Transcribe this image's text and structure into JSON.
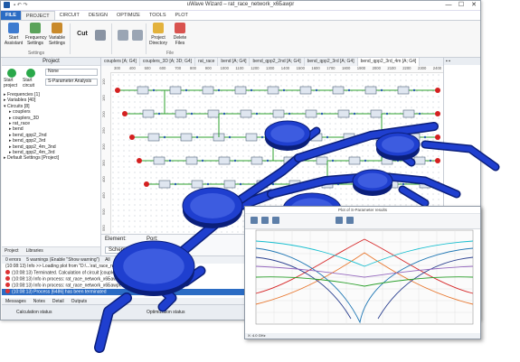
{
  "window": {
    "title": "uWave Wizard – rat_race_network_x6Бawpr",
    "qa_icons": [
      "save-icon",
      "undo-icon",
      "redo-icon"
    ],
    "controls": {
      "minimize": "—",
      "maximize": "☐",
      "close": "✕"
    }
  },
  "ribbon": {
    "tabs": [
      "FILE",
      "PROJECT",
      "CIRCUIT",
      "DESIGN",
      "OPTIMIZE",
      "TOOLS",
      "PLOT"
    ],
    "active_tab": "PROJECT",
    "settings_buttons": [
      "Start Assistant",
      "Frequency Settings",
      "Variable Settings"
    ],
    "settings_group": "Settings",
    "cut_label": "Cut",
    "file_buttons": [
      "Project Directory",
      "Delete Files"
    ],
    "file_group": "File"
  },
  "project_panel": {
    "header": "Project",
    "start_project": "Start project",
    "start_circuit": "Start circuit",
    "none_select": "None",
    "analysis": "S-Parameter Analysis",
    "tree": [
      "▸ Frequencies [1]",
      "▸ Variables [40]",
      "▾ Circuits [8]",
      "▸ couplers",
      "▸ couplers_3D",
      "▸ rat_race",
      "▸ bend",
      "▸ bend_qpp2_2nd",
      "▸ bend_qpp2_3rd",
      "▸ bend_qpp2_4m_3nd",
      "▸ bend_qpp2_4m_3rd",
      "▸ Default Settings [Project]"
    ],
    "footer_tabs": [
      "Project",
      "Libraries"
    ]
  },
  "canvas": {
    "tabs": [
      "couplers [A; G4]",
      "couplers_3D [A; 3D; G4]",
      "rat_race",
      "bend [A; G4]",
      "bend_qpp2_2nd [A; G4]",
      "bend_qpp2_3rd [A; G4]",
      "bend_qpp2_3rd_4m [A; G4]"
    ],
    "active_tab": 6,
    "ruler_x": [
      "300",
      "400",
      "500",
      "600",
      "700",
      "800",
      "900",
      "1000",
      "1100",
      "1200",
      "1300",
      "1400",
      "1500",
      "1600",
      "1700",
      "1800",
      "1900",
      "2000",
      "2100",
      "2200",
      "2300",
      "2400"
    ],
    "ruler_y": [
      "100",
      "150",
      "200",
      "250",
      "300",
      "350",
      "400",
      "450",
      "500",
      "550"
    ]
  },
  "properties": {
    "element": "Element:",
    "port": "Port:",
    "schematic_tab": "Schematic"
  },
  "messages": {
    "toolbar": [
      "0 errors",
      "5 warnings (Enable \"Show warning\")",
      "All"
    ],
    "rows": [
      {
        "text": "(10:08:13)  Info   >> Loading plot from \"D:\\...\\rat_race_network_x6Бawpr\\couplers.xpd\"  (RK)",
        "error": false,
        "selected": false
      },
      {
        "text": "(10:08:13)  Terminated. Calculation of circuit [couplers] aborted",
        "error": true,
        "selected": false
      },
      {
        "text": "(10:08:13)  Info in process: rat_race_network_x6Бawpr... checking licence",
        "error": true,
        "selected": false
      },
      {
        "text": "(10:08:13)  Info in process: rat_race_network_x6Бawpr... running",
        "error": true,
        "selected": false
      },
      {
        "text": "(10:08:13)  Process [6486] has been terminated",
        "error": true,
        "selected": true
      }
    ],
    "tabs": [
      "Messages",
      "Notes",
      "Detail",
      "Outputs"
    ]
  },
  "status": {
    "left": "Calculation status",
    "center": "Optimization status"
  },
  "plot_window": {
    "title": "Plot of S-Parameter results",
    "status": "X: 4.0 GHz"
  },
  "colors": {
    "accent": "#2b6cc4",
    "model_blue": "#1f3fcf",
    "port_red": "#d42020",
    "wire_green": "#2ca02c"
  }
}
